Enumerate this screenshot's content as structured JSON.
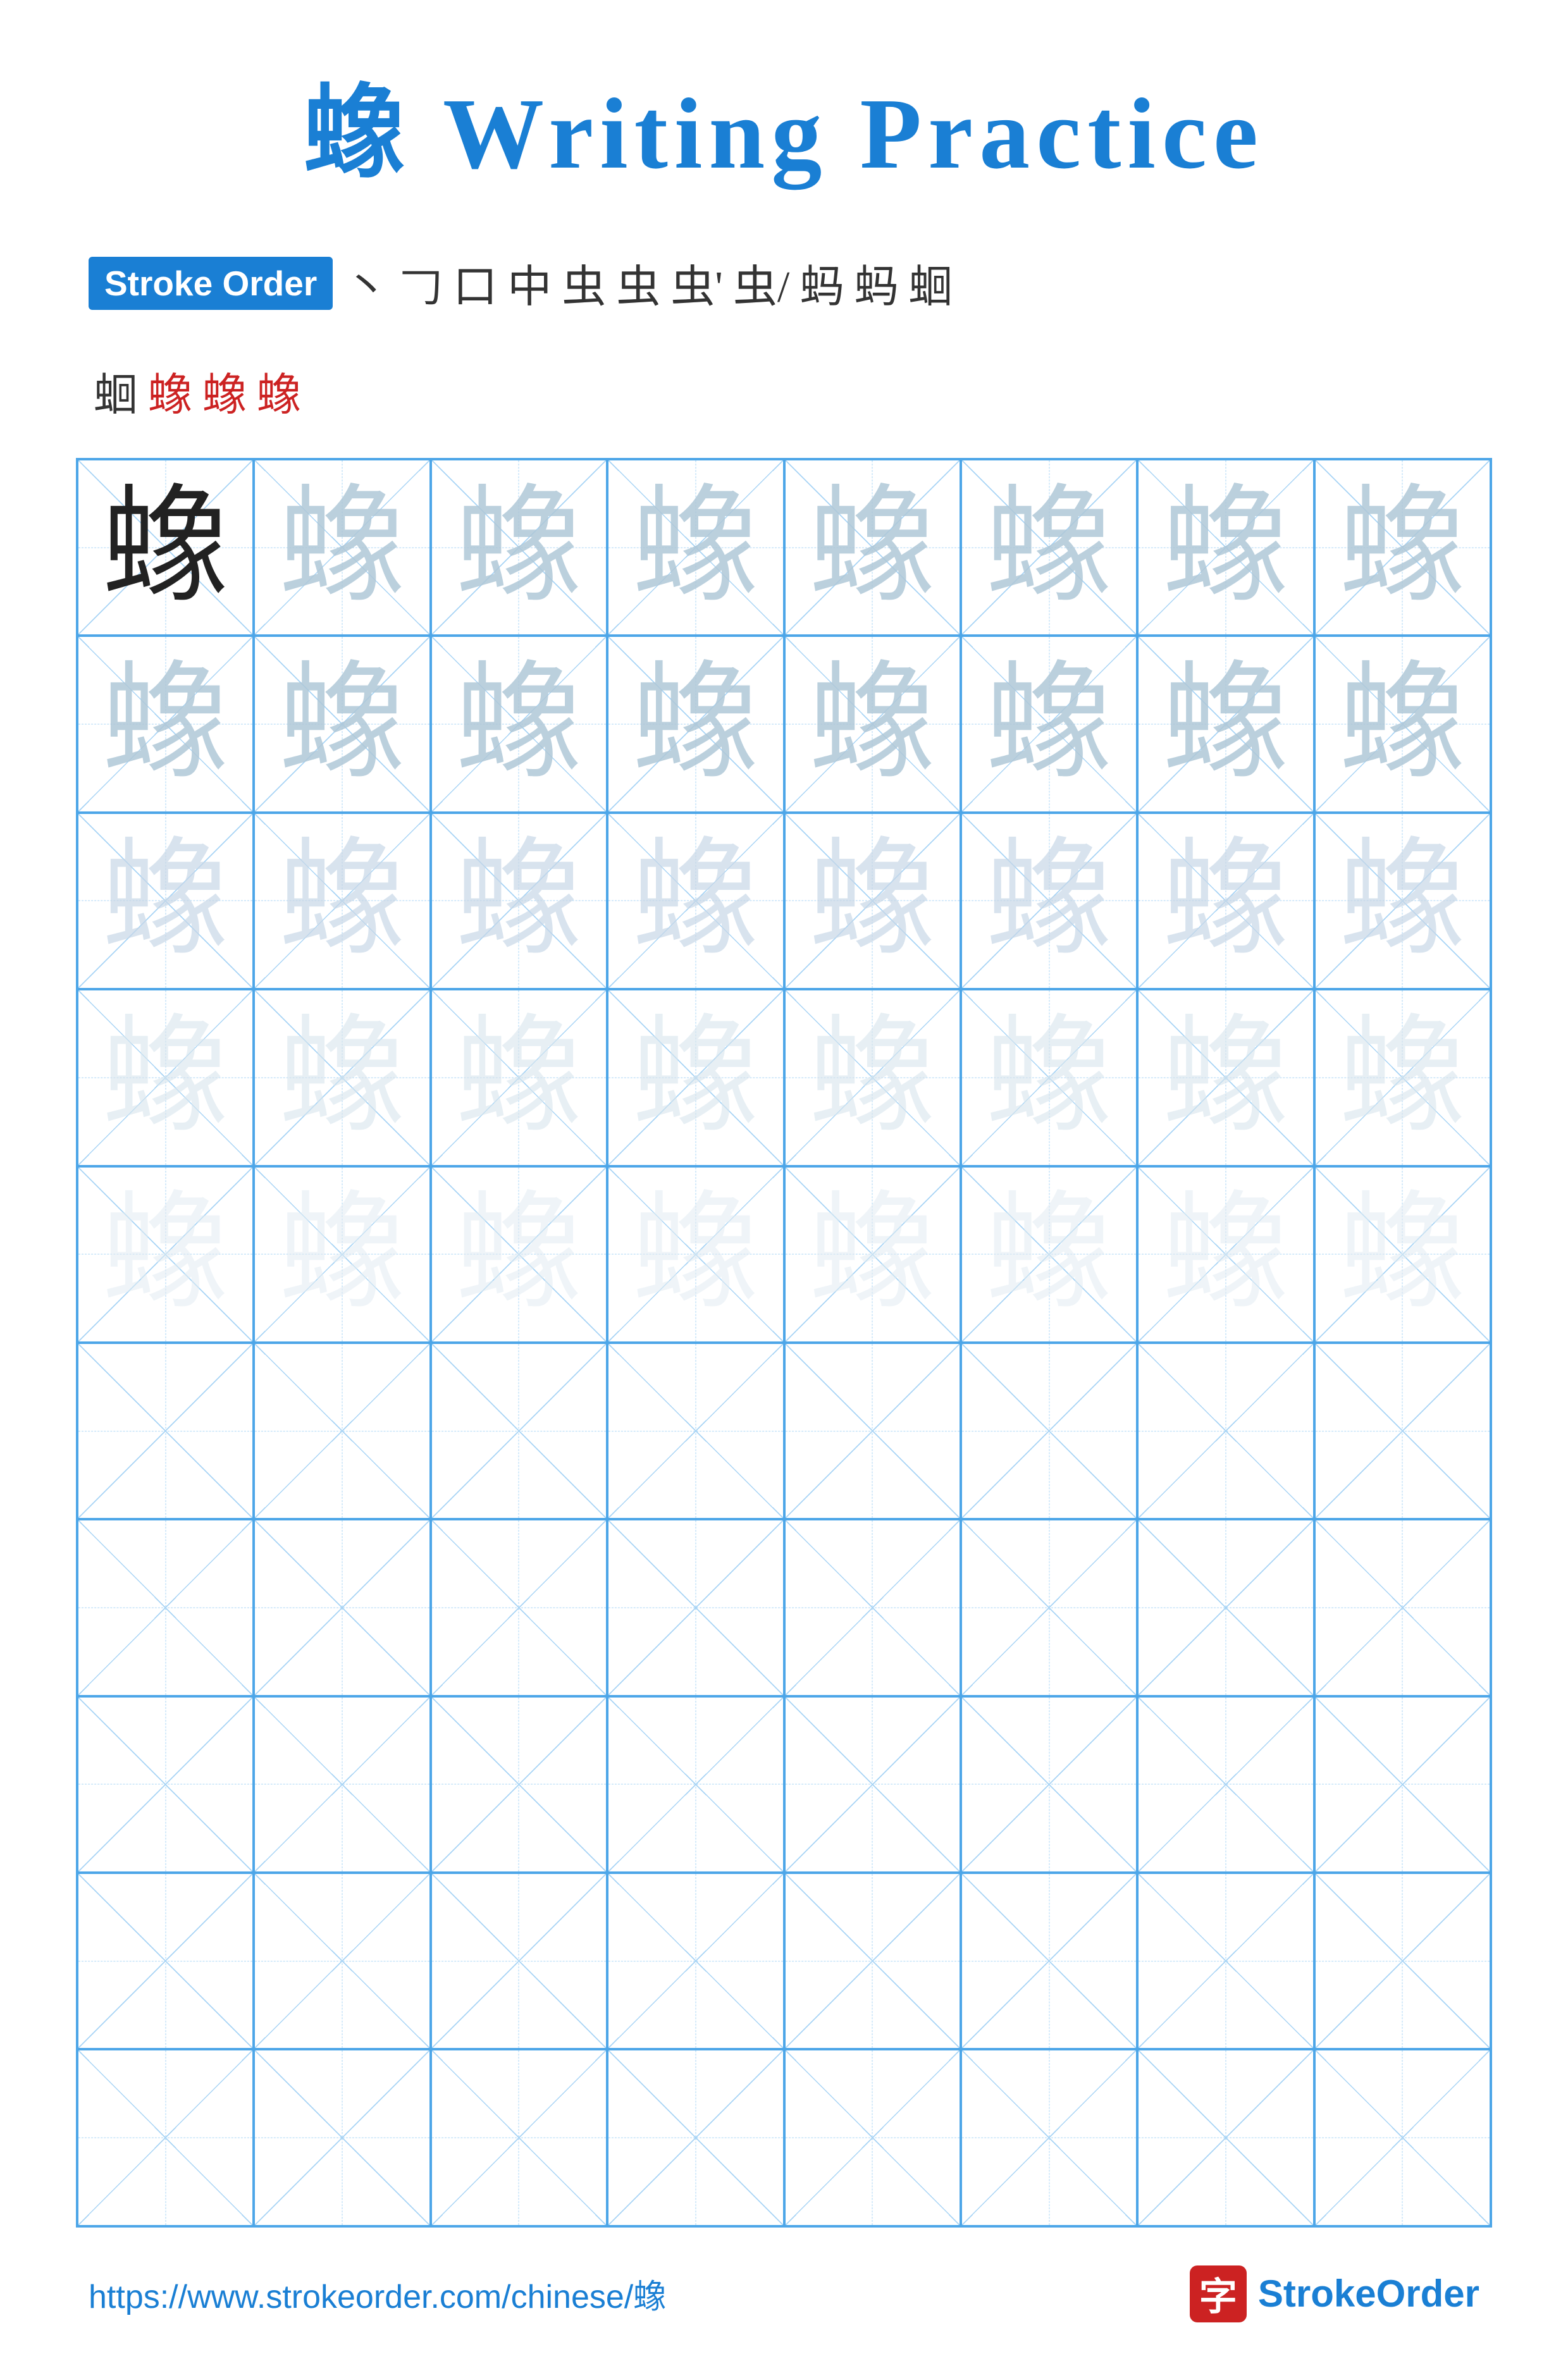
{
  "title": {
    "char": "蟓",
    "suffix": " Writing Practice"
  },
  "stroke_order": {
    "label": "Stroke Order",
    "strokes": [
      "丶",
      "𠃌",
      "口",
      "中",
      "虫",
      "虫",
      "虫'",
      "虫/",
      "蚂",
      "蚂",
      "蛔"
    ],
    "strokes_row2": [
      "蛔",
      "蟓",
      "蟓",
      "蟓"
    ]
  },
  "grid": {
    "rows": 10,
    "cols": 8,
    "char": "蟓",
    "char_rows": [
      [
        "dark",
        "light1",
        "light1",
        "light1",
        "light1",
        "light1",
        "light1",
        "light1"
      ],
      [
        "light1",
        "light1",
        "light1",
        "light1",
        "light1",
        "light1",
        "light1",
        "light1"
      ],
      [
        "light2",
        "light2",
        "light2",
        "light2",
        "light2",
        "light2",
        "light2",
        "light2"
      ],
      [
        "light3",
        "light3",
        "light3",
        "light3",
        "light3",
        "light3",
        "light3",
        "light3"
      ],
      [
        "light4",
        "light4",
        "light4",
        "light4",
        "light4",
        "light4",
        "light4",
        "light4"
      ],
      [
        "empty",
        "empty",
        "empty",
        "empty",
        "empty",
        "empty",
        "empty",
        "empty"
      ],
      [
        "empty",
        "empty",
        "empty",
        "empty",
        "empty",
        "empty",
        "empty",
        "empty"
      ],
      [
        "empty",
        "empty",
        "empty",
        "empty",
        "empty",
        "empty",
        "empty",
        "empty"
      ],
      [
        "empty",
        "empty",
        "empty",
        "empty",
        "empty",
        "empty",
        "empty",
        "empty"
      ],
      [
        "empty",
        "empty",
        "empty",
        "empty",
        "empty",
        "empty",
        "empty",
        "empty"
      ]
    ]
  },
  "footer": {
    "url": "https://www.strokeorder.com/chinese/蟓",
    "brand_char": "字",
    "brand_name_part1": "Stroke",
    "brand_name_part2": "Order"
  }
}
